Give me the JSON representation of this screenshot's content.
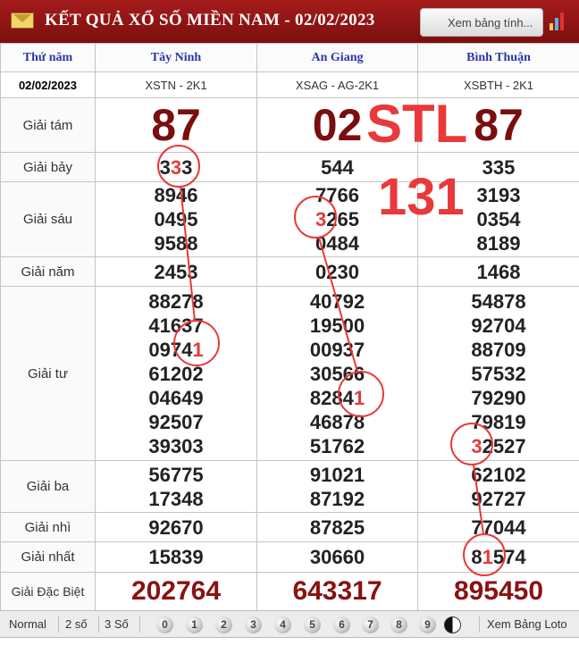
{
  "header": {
    "title": "KẾT QUẢ XỔ SỐ MIỀN NAM - 02/02/2023",
    "view_link": "Xem bảng tính..."
  },
  "table": {
    "day_label": "Thứ năm",
    "date": "02/02/2023",
    "provinces": [
      {
        "name": "Tây Ninh",
        "code": "XSTN - 2K1"
      },
      {
        "name": "An Giang",
        "code": "XSAG - AG-2K1"
      },
      {
        "name": "Bình Thuận",
        "code": "XSBTH - 2K1"
      }
    ],
    "prizes": {
      "g8": {
        "label": "Giải tám",
        "values": [
          "87",
          "02",
          "87"
        ]
      },
      "g7": {
        "label": "Giải bảy",
        "values": [
          "333",
          "544",
          "335"
        ]
      },
      "g6": {
        "label": "Giải sáu",
        "values": [
          [
            "8946",
            "0495",
            "9588"
          ],
          [
            "7766",
            "3265",
            "0484"
          ],
          [
            "3193",
            "0354",
            "8189"
          ]
        ]
      },
      "g5": {
        "label": "Giải năm",
        "values": [
          "2453",
          "0230",
          "1468"
        ]
      },
      "g4": {
        "label": "Giải tư",
        "values": [
          [
            "88278",
            "41637",
            "09741",
            "61202",
            "04649",
            "92507",
            "39303"
          ],
          [
            "40792",
            "19500",
            "00937",
            "30566",
            "82841",
            "46878",
            "51762"
          ],
          [
            "54878",
            "92704",
            "88709",
            "57532",
            "79290",
            "79819",
            "32527"
          ]
        ]
      },
      "g3": {
        "label": "Giải ba",
        "values": [
          [
            "56775",
            "17348"
          ],
          [
            "91021",
            "87192"
          ],
          [
            "62102",
            "92727"
          ]
        ]
      },
      "g2": {
        "label": "Giải nhì",
        "values": [
          "92670",
          "87825",
          "77044"
        ]
      },
      "g1": {
        "label": "Giải nhất",
        "values": [
          "15839",
          "30660",
          "81574"
        ]
      },
      "db": {
        "label": "Giải Đặc Biệt",
        "values": [
          "202764",
          "643317",
          "895450"
        ]
      }
    }
  },
  "overlay": {
    "line1": "STL",
    "line2": "131",
    "color": "#e9393a"
  },
  "footer": {
    "modes": [
      "Normal",
      "2 số",
      "3 Số"
    ],
    "digits": [
      "0",
      "1",
      "2",
      "3",
      "4",
      "5",
      "6",
      "7",
      "8",
      "9"
    ],
    "loto_link": "Xem Bảng Loto"
  }
}
